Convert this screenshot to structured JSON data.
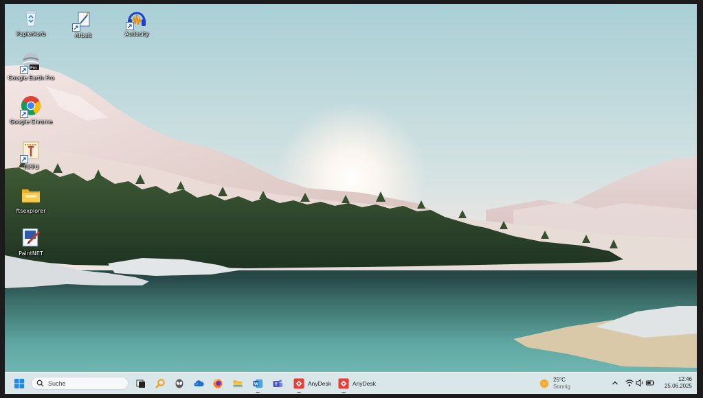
{
  "desktop": {
    "icons": [
      {
        "label": "Papierkorb",
        "icon": "recycle-bin-icon"
      },
      {
        "label": "Arbeit",
        "icon": "folder-shortcut-icon"
      },
      {
        "label": "Audacity",
        "icon": "audacity-icon"
      },
      {
        "label": "Google Earth Pro",
        "icon": "google-earth-icon"
      },
      {
        "label": "Google Chrome",
        "icon": "chrome-icon"
      },
      {
        "label": "TIPPU",
        "icon": "tippu-icon"
      },
      {
        "label": "ftsexplorer",
        "icon": "folder-icon"
      },
      {
        "label": "PaintNET",
        "icon": "paintnet-icon"
      }
    ],
    "shortcut_overlay": "shortcut-arrow-icon"
  },
  "taskbar": {
    "start": "windows-start-icon",
    "search": {
      "placeholder": "Suche",
      "icon": "search-icon"
    },
    "pinned": [
      "task-view-icon",
      "search-tool-icon",
      "alien-app-icon",
      "cloud-app-icon",
      "firefox-icon",
      "file-explorer-icon",
      "word-icon",
      "teams-icon"
    ],
    "apps": [
      {
        "label": "AnyDesk",
        "icon": "anydesk-icon"
      },
      {
        "label": "AnyDesk",
        "icon": "anydesk-icon"
      }
    ],
    "weather": {
      "temp": "25°C",
      "condition": "Sonnig",
      "icon": "sun-icon"
    },
    "tray": [
      "chevron-up-icon",
      "wifi-icon",
      "speaker-icon",
      "battery-icon"
    ],
    "clock": {
      "time": "12:46",
      "date": "25.06.2025"
    }
  },
  "colors": {
    "taskbar_bg": "#e2eaee",
    "windows_blue": "#1f8ae8",
    "anydesk_red": "#ef3b36"
  }
}
